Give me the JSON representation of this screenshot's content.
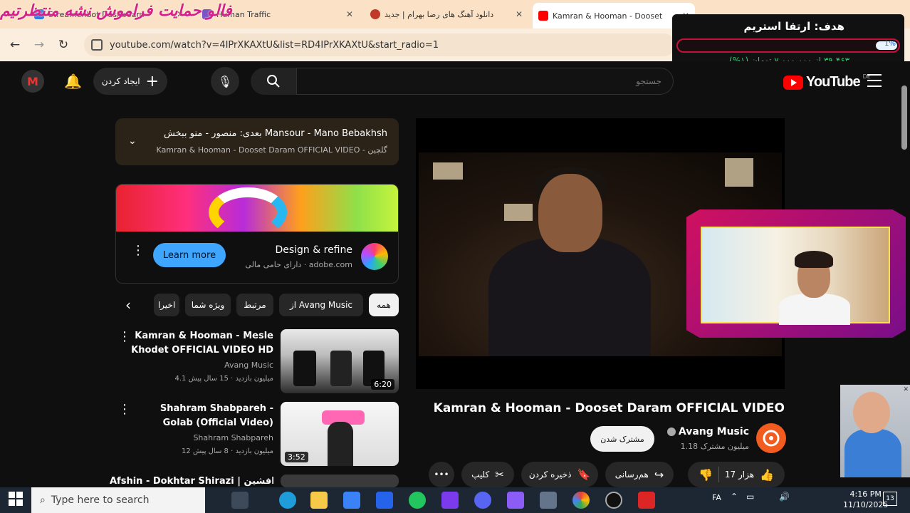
{
  "browser": {
    "tabs": [
      {
        "label": "Streamer.bot Dashboard",
        "close": "✕"
      },
      {
        "label": "Human Traffic",
        "close": "✕"
      },
      {
        "label": "دانلود آهنگ های رضا بهرام | جدید",
        "close": "✕"
      },
      {
        "label": "Kamran & Hooman - Dooset",
        "close": "✕"
      }
    ],
    "url": "youtube.com/watch?v=4IPrXKAXtU&list=RD4IPrXKAXtU&start_radio=1",
    "overlay_text": "فالو  حمایت فراموش نشه منتظرتیم"
  },
  "goal": {
    "title": "هدف: ارتقا استریم",
    "percent_label": "1%",
    "subtitle": "۳۹،۴۶۳ از ۷،۰۰۰،۰۰۰ تومان (۱%)",
    "progress": 0.01
  },
  "youtube": {
    "brand": "YouTube",
    "region": "DE",
    "search_placeholder": "جستجو",
    "create_label": "ایجاد کردن",
    "avatar_letter": "M"
  },
  "mix": {
    "title": "بعدی: منصور - منو ببخش Mansour - Mano Bebakhsh",
    "subtitle": "Kamran & Hooman - Dooset Daram OFFICIAL VIDEO - گلچین"
  },
  "ad": {
    "title": "Design & refine",
    "subtitle": "دارای حامی مالی · adobe.com",
    "button": "Learn more"
  },
  "chips": [
    "همه",
    "از Avang Music",
    "مرتبط",
    "ویژه شما",
    "اخیرا"
  ],
  "related": [
    {
      "title": "Kamran & Hooman - Mesle Khodet OFFICIAL VIDEO HD",
      "channel": "Avang Music",
      "meta": "4.1 میلیون بازدید · 15 سال پیش",
      "duration": "6:20"
    },
    {
      "title": "Shahram Shabpareh - Golab (Official Video)",
      "channel": "Shahram Shabpareh",
      "meta": "12 میلیون بازدید · 8 سال پیش",
      "duration": "3:52"
    },
    {
      "title": "Afshin - Dokhtar Shirazi | افشین",
      "channel": "",
      "meta": "",
      "duration": ""
    }
  ],
  "video": {
    "title": "Kamran & Hooman - Dooset Daram OFFICIAL VIDEO",
    "channel": "Avang Music",
    "subs": "1.18 میلیون مشترک",
    "subscribe": "مشترک شدن",
    "likes": "17 هزار",
    "share": "هم‌رسانی",
    "save": "ذخیره کردن",
    "clip": "کلیپ"
  },
  "taskbar": {
    "search": "Type here to search",
    "lang": "FA",
    "time": "4:16 PM",
    "date": "11/10/2025",
    "notif": "13"
  },
  "colors": {
    "accent": "#ff0000",
    "tabbar": "#fbe2c6",
    "link": "#3ea6ff",
    "goal_border": "#c4113a"
  }
}
